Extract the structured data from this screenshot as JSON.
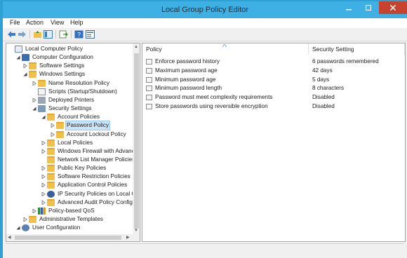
{
  "window": {
    "title": "Local Group Policy Editor",
    "accent": "#3fb0e4",
    "close_color": "#c7432d"
  },
  "menubar": {
    "items": [
      "File",
      "Action",
      "View",
      "Help"
    ]
  },
  "toolbar": {
    "buttons": [
      "back-arrow-icon",
      "forward-arrow-icon",
      "up-folder-icon",
      "show-hide-tree-icon",
      "export-list-icon",
      "help-icon",
      "properties-icon"
    ]
  },
  "tree": {
    "items": [
      {
        "label": "Local Computer Policy",
        "level": 0,
        "expanded": true
      },
      {
        "label": "Computer Configuration",
        "level": 1,
        "expanded": true
      },
      {
        "label": "Software Settings",
        "level": 2,
        "expanded": false
      },
      {
        "label": "Windows Settings",
        "level": 2,
        "expanded": true
      },
      {
        "label": "Name Resolution Policy",
        "level": 3,
        "expanded": false
      },
      {
        "label": "Scripts (Startup/Shutdown)",
        "level": 3,
        "expanded": null
      },
      {
        "label": "Deployed Printers",
        "level": 3,
        "expanded": false
      },
      {
        "label": "Security Settings",
        "level": 3,
        "expanded": true
      },
      {
        "label": "Account Policies",
        "level": 4,
        "expanded": true
      },
      {
        "label": "Password Policy",
        "level": 5,
        "expanded": false,
        "selected": true
      },
      {
        "label": "Account Lockout Policy",
        "level": 5,
        "expanded": false
      },
      {
        "label": "Local Policies",
        "level": 4,
        "expanded": false
      },
      {
        "label": "Windows Firewall with Advanc",
        "level": 4,
        "expanded": false
      },
      {
        "label": "Network List Manager Policies",
        "level": 4,
        "expanded": null
      },
      {
        "label": "Public Key Policies",
        "level": 4,
        "expanded": false
      },
      {
        "label": "Software Restriction Policies",
        "level": 4,
        "expanded": false
      },
      {
        "label": "Application Control Policies",
        "level": 4,
        "expanded": false
      },
      {
        "label": "IP Security Policies on Local Co",
        "level": 4,
        "expanded": false
      },
      {
        "label": "Advanced Audit Policy Configu",
        "level": 4,
        "expanded": false
      },
      {
        "label": "Policy-based QoS",
        "level": 3,
        "expanded": false
      },
      {
        "label": "Administrative Templates",
        "level": 2,
        "expanded": false
      },
      {
        "label": "User Configuration",
        "level": 1,
        "expanded": true
      }
    ]
  },
  "list": {
    "columns": [
      "Policy",
      "Security Setting"
    ],
    "rows": [
      {
        "policy": "Enforce password history",
        "setting": "6 passwords remembered"
      },
      {
        "policy": "Maximum password age",
        "setting": "42 days"
      },
      {
        "policy": "Minimum password age",
        "setting": "5 days"
      },
      {
        "policy": "Minimum password length",
        "setting": "8 characters"
      },
      {
        "policy": "Password must meet complexity requirements",
        "setting": "Disabled"
      },
      {
        "policy": "Store passwords using reversible encryption",
        "setting": "Disabled"
      }
    ]
  }
}
